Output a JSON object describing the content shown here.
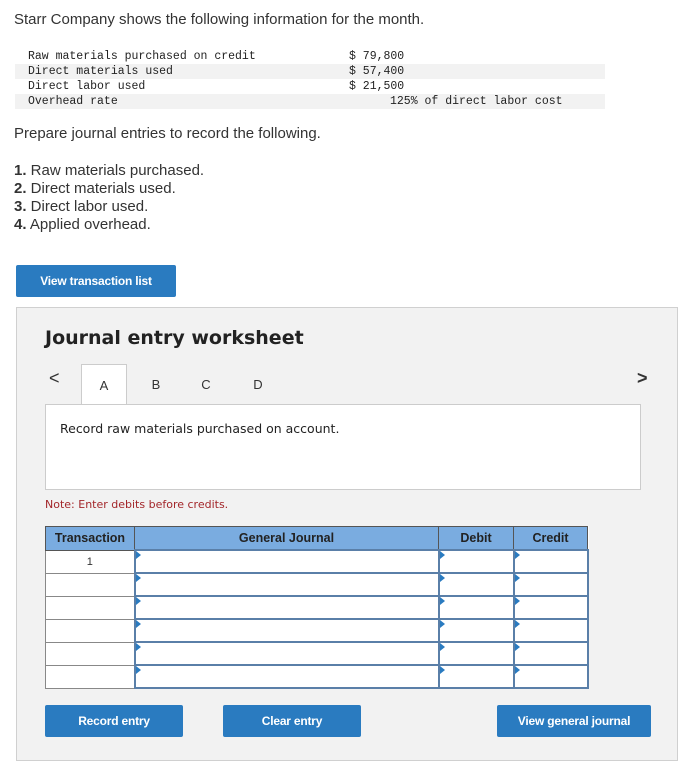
{
  "intro": "Starr Company shows the following information for the month.",
  "info": [
    {
      "label": "Raw materials purchased on credit",
      "value": "$ 79,800"
    },
    {
      "label": "Direct materials used",
      "value": "$ 57,400"
    },
    {
      "label": "Direct labor used",
      "value": "$ 21,500"
    },
    {
      "label": "Overhead rate",
      "value": "125% of direct labor cost"
    }
  ],
  "prepare": "Prepare journal entries to record the following.",
  "tasks": [
    {
      "num": "1.",
      "text": " Raw materials purchased."
    },
    {
      "num": "2.",
      "text": " Direct materials used."
    },
    {
      "num": "3.",
      "text": " Direct labor used."
    },
    {
      "num": "4.",
      "text": " Applied overhead."
    }
  ],
  "view_transaction_list": "View transaction list",
  "worksheet": {
    "title": "Journal entry worksheet",
    "tabs": [
      "A",
      "B",
      "C",
      "D"
    ],
    "prev_arrow": "<",
    "next_arrow": ">",
    "prompt": "Record raw materials purchased on account.",
    "note": "Note: Enter debits before credits.",
    "headers": {
      "transaction": "Transaction",
      "journal": "General Journal",
      "debit": "Debit",
      "credit": "Credit"
    },
    "rows": [
      "1",
      "",
      "",
      "",
      "",
      ""
    ],
    "record_entry": "Record entry",
    "clear_entry": "Clear entry",
    "view_general_journal": "View general journal"
  },
  "colors": {
    "accent": "#2a7bc0",
    "header_bg": "#7aace0",
    "note": "#a3262a",
    "panel_bg": "#f2f2f2"
  }
}
